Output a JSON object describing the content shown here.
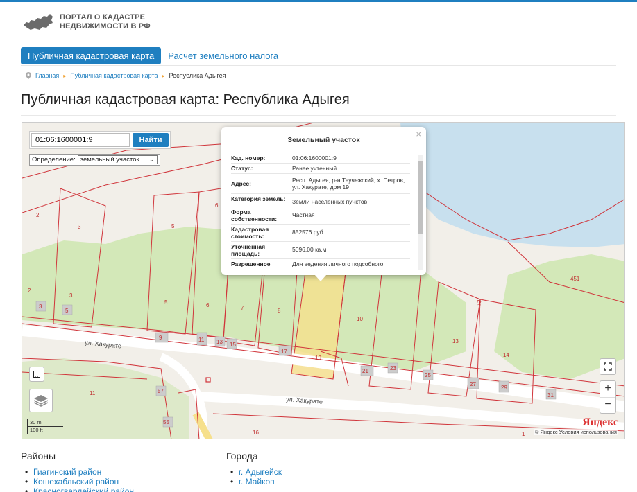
{
  "header": {
    "logo_line1": "ПОРТАЛ О КАДАСТРЕ",
    "logo_line2": "НЕДВИЖИМОСТИ В РФ"
  },
  "nav": {
    "tabs": [
      {
        "label": "Публичная кадастровая карта",
        "active": true
      },
      {
        "label": "Расчет земельного налога",
        "active": false
      }
    ]
  },
  "breadcrumb": {
    "items": [
      "Главная",
      "Публичная кадастровая карта",
      "Республика Адыгея"
    ]
  },
  "page": {
    "title": "Публичная кадастровая карта: Республика Адыгея"
  },
  "map": {
    "search_value": "01:06:1600001:9",
    "search_button": "Найти",
    "definition_label": "Определение:",
    "definition_value": "земельный участок",
    "popup": {
      "title": "Земельный участок",
      "close": "×",
      "rows": [
        {
          "key": "Кад. номер:",
          "value": "01:06:1600001:9"
        },
        {
          "key": "Статус:",
          "value": "Ранее учтенный"
        },
        {
          "key": "Адрес:",
          "value": "Респ. Адыгея, р-н Теучежский, х. Петров, ул. Хакурате, дом 19"
        },
        {
          "key": "Категория земель:",
          "value": "Земли населенных пунктов"
        },
        {
          "key": "Форма собственности:",
          "value": "Частная"
        },
        {
          "key": "Кадастровая стоимость:",
          "value": "852576 руб"
        },
        {
          "key": "Уточненная площадь:",
          "value": "5096.00 кв.м"
        },
        {
          "key": "Разрешенное",
          "value": "Для ведения личного подсобного"
        }
      ]
    },
    "street_labels": [
      "ул. Хакурате",
      "ул. Хакурате"
    ],
    "parcel_numbers": [
      "2",
      "3",
      "5",
      "6",
      "2",
      "3",
      "3",
      "5",
      "5",
      "6",
      "7",
      "8",
      "10",
      "451",
      "9",
      "11",
      "13",
      "15",
      "17",
      "19",
      "21",
      "23",
      "25",
      "13",
      "13",
      "14",
      "27",
      "29",
      "31",
      "11",
      "57",
      "55",
      "16",
      "1"
    ],
    "scale_m": "30 m",
    "scale_ft": "100 ft",
    "zoom_in": "+",
    "zoom_out": "−",
    "brand": "Яндекс",
    "terms": "© Яндекс  Условия использования"
  },
  "districts": {
    "title": "Районы",
    "items": [
      "Гиагинский район",
      "Кошехабльский район",
      "Красногвардейский район"
    ]
  },
  "cities": {
    "title": "Города",
    "items": [
      "г. Адыгейск",
      "г. Майкоп"
    ]
  },
  "colors": {
    "accent": "#1f7fc0",
    "parcel_line": "#d0343a",
    "water": "#c8e0ee",
    "greenery": "#d3e8b8",
    "highlight": "#f6e08c"
  }
}
